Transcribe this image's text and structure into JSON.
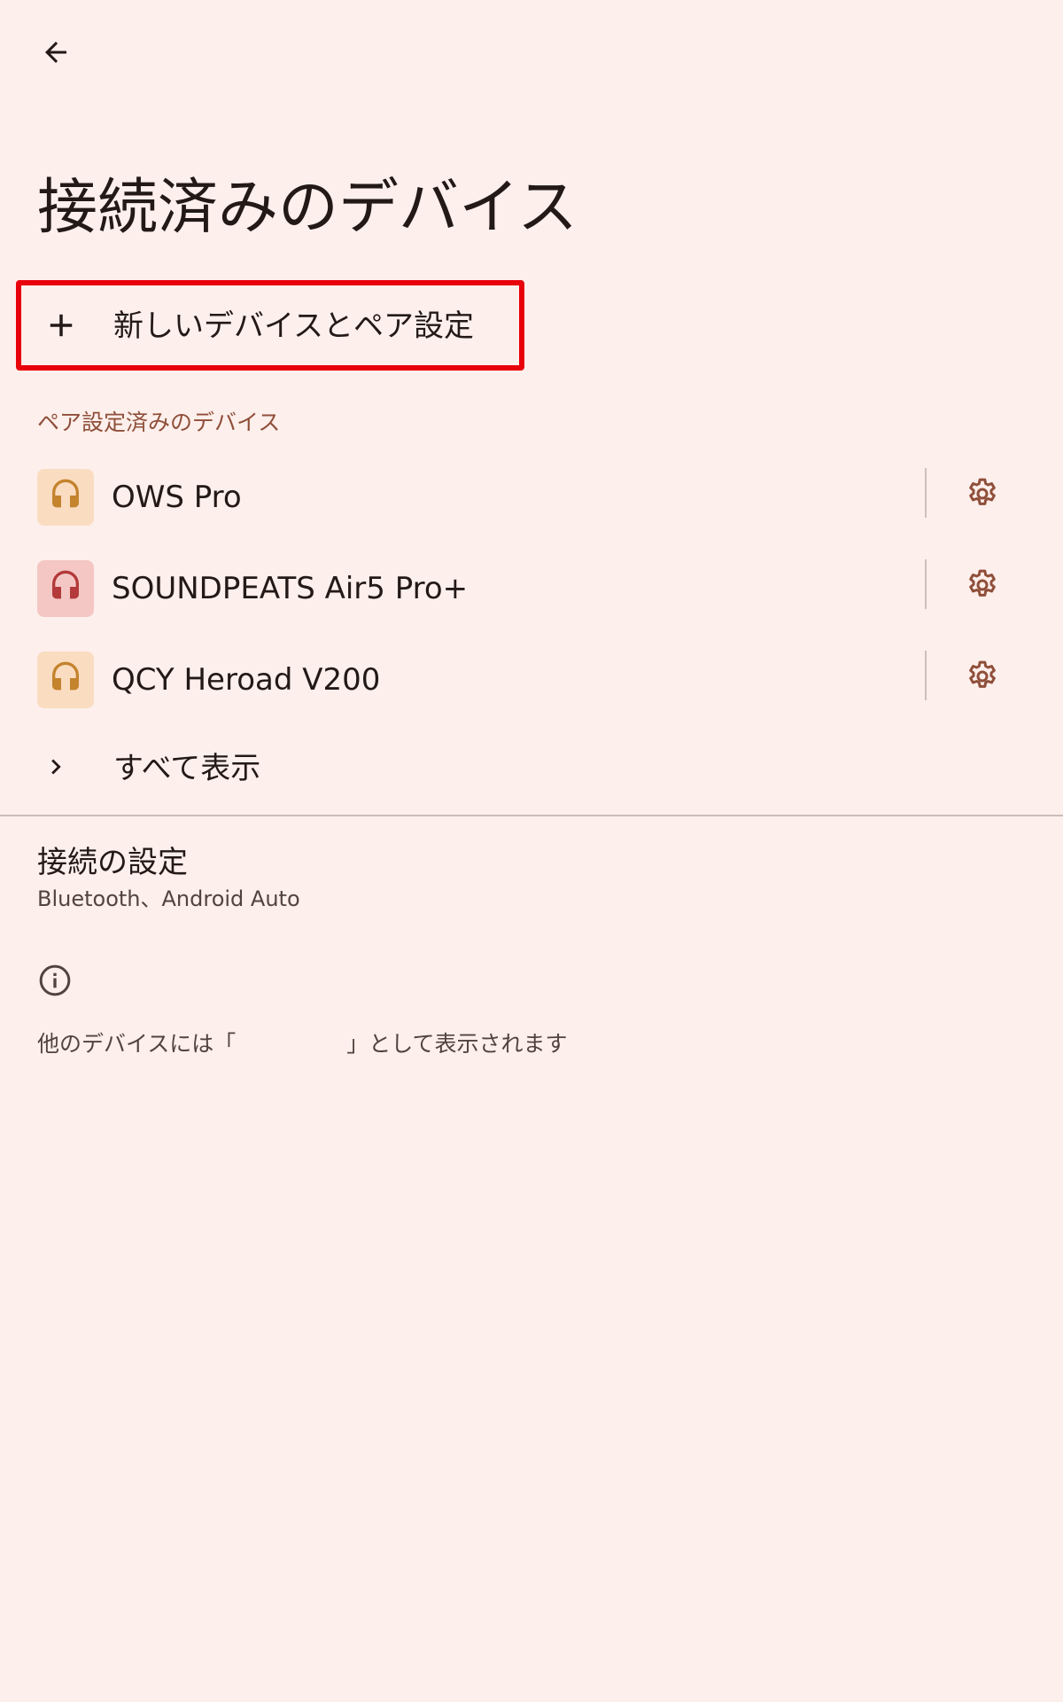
{
  "header": {
    "back_icon": "arrow-back-icon",
    "title": "接続済みのデバイス"
  },
  "pair_new": {
    "icon": "plus-icon",
    "label": "新しいデバイスとペア設定",
    "highlight_color": "#e8000a"
  },
  "paired_section": {
    "header": "ペア設定済みのデバイス",
    "devices": [
      {
        "name": "OWS Pro",
        "icon": "headset-icon",
        "icon_color": "#c4832d",
        "icon_bg": "#fadcc1",
        "settings_icon": "gear-icon"
      },
      {
        "name": "SOUNDPEATS Air5 Pro+",
        "icon": "headset-icon",
        "icon_color": "#b3393a",
        "icon_bg": "#f4c7c4",
        "settings_icon": "gear-icon"
      },
      {
        "name": "QCY Heroad V200",
        "icon": "headset-icon",
        "icon_color": "#c4832d",
        "icon_bg": "#fadcc1",
        "settings_icon": "gear-icon"
      }
    ],
    "see_all": {
      "icon": "chevron-right-icon",
      "label": "すべて表示"
    }
  },
  "connection_prefs": {
    "title": "接続の設定",
    "subtitle": "Bluetooth、Android Auto"
  },
  "footer": {
    "icon": "info-icon",
    "text": "他のデバイスには「　　　　　」として表示されます"
  },
  "colors": {
    "background": "#fdefeb",
    "accent": "#8f4f3a",
    "settings_icon": "#8f4f3a"
  }
}
